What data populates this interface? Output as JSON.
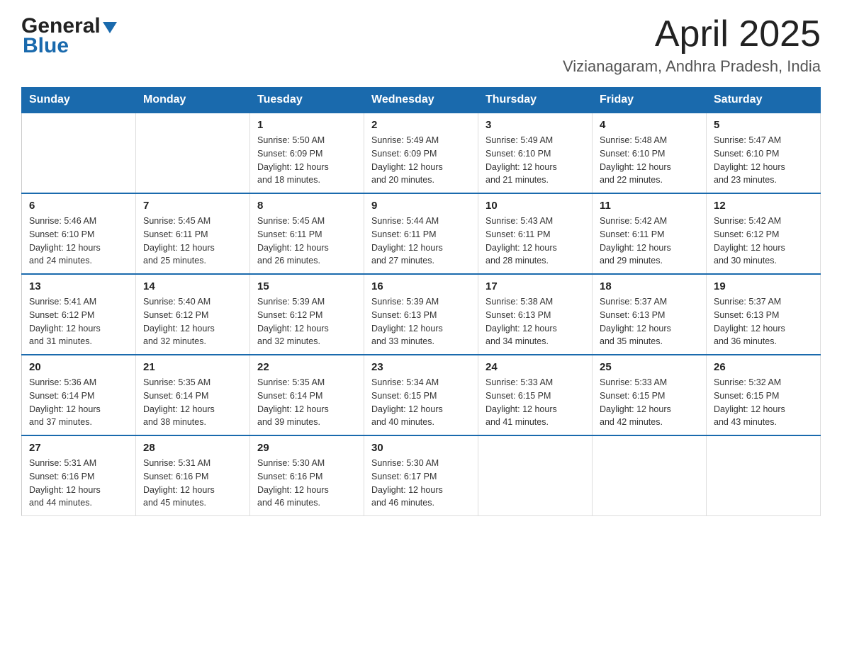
{
  "header": {
    "logo": {
      "general": "General",
      "blue": "Blue"
    },
    "title": "April 2025",
    "location": "Vizianagaram, Andhra Pradesh, India"
  },
  "calendar": {
    "days_of_week": [
      "Sunday",
      "Monday",
      "Tuesday",
      "Wednesday",
      "Thursday",
      "Friday",
      "Saturday"
    ],
    "weeks": [
      [
        {
          "day": "",
          "info": ""
        },
        {
          "day": "",
          "info": ""
        },
        {
          "day": "1",
          "info": "Sunrise: 5:50 AM\nSunset: 6:09 PM\nDaylight: 12 hours\nand 18 minutes."
        },
        {
          "day": "2",
          "info": "Sunrise: 5:49 AM\nSunset: 6:09 PM\nDaylight: 12 hours\nand 20 minutes."
        },
        {
          "day": "3",
          "info": "Sunrise: 5:49 AM\nSunset: 6:10 PM\nDaylight: 12 hours\nand 21 minutes."
        },
        {
          "day": "4",
          "info": "Sunrise: 5:48 AM\nSunset: 6:10 PM\nDaylight: 12 hours\nand 22 minutes."
        },
        {
          "day": "5",
          "info": "Sunrise: 5:47 AM\nSunset: 6:10 PM\nDaylight: 12 hours\nand 23 minutes."
        }
      ],
      [
        {
          "day": "6",
          "info": "Sunrise: 5:46 AM\nSunset: 6:10 PM\nDaylight: 12 hours\nand 24 minutes."
        },
        {
          "day": "7",
          "info": "Sunrise: 5:45 AM\nSunset: 6:11 PM\nDaylight: 12 hours\nand 25 minutes."
        },
        {
          "day": "8",
          "info": "Sunrise: 5:45 AM\nSunset: 6:11 PM\nDaylight: 12 hours\nand 26 minutes."
        },
        {
          "day": "9",
          "info": "Sunrise: 5:44 AM\nSunset: 6:11 PM\nDaylight: 12 hours\nand 27 minutes."
        },
        {
          "day": "10",
          "info": "Sunrise: 5:43 AM\nSunset: 6:11 PM\nDaylight: 12 hours\nand 28 minutes."
        },
        {
          "day": "11",
          "info": "Sunrise: 5:42 AM\nSunset: 6:11 PM\nDaylight: 12 hours\nand 29 minutes."
        },
        {
          "day": "12",
          "info": "Sunrise: 5:42 AM\nSunset: 6:12 PM\nDaylight: 12 hours\nand 30 minutes."
        }
      ],
      [
        {
          "day": "13",
          "info": "Sunrise: 5:41 AM\nSunset: 6:12 PM\nDaylight: 12 hours\nand 31 minutes."
        },
        {
          "day": "14",
          "info": "Sunrise: 5:40 AM\nSunset: 6:12 PM\nDaylight: 12 hours\nand 32 minutes."
        },
        {
          "day": "15",
          "info": "Sunrise: 5:39 AM\nSunset: 6:12 PM\nDaylight: 12 hours\nand 32 minutes."
        },
        {
          "day": "16",
          "info": "Sunrise: 5:39 AM\nSunset: 6:13 PM\nDaylight: 12 hours\nand 33 minutes."
        },
        {
          "day": "17",
          "info": "Sunrise: 5:38 AM\nSunset: 6:13 PM\nDaylight: 12 hours\nand 34 minutes."
        },
        {
          "day": "18",
          "info": "Sunrise: 5:37 AM\nSunset: 6:13 PM\nDaylight: 12 hours\nand 35 minutes."
        },
        {
          "day": "19",
          "info": "Sunrise: 5:37 AM\nSunset: 6:13 PM\nDaylight: 12 hours\nand 36 minutes."
        }
      ],
      [
        {
          "day": "20",
          "info": "Sunrise: 5:36 AM\nSunset: 6:14 PM\nDaylight: 12 hours\nand 37 minutes."
        },
        {
          "day": "21",
          "info": "Sunrise: 5:35 AM\nSunset: 6:14 PM\nDaylight: 12 hours\nand 38 minutes."
        },
        {
          "day": "22",
          "info": "Sunrise: 5:35 AM\nSunset: 6:14 PM\nDaylight: 12 hours\nand 39 minutes."
        },
        {
          "day": "23",
          "info": "Sunrise: 5:34 AM\nSunset: 6:15 PM\nDaylight: 12 hours\nand 40 minutes."
        },
        {
          "day": "24",
          "info": "Sunrise: 5:33 AM\nSunset: 6:15 PM\nDaylight: 12 hours\nand 41 minutes."
        },
        {
          "day": "25",
          "info": "Sunrise: 5:33 AM\nSunset: 6:15 PM\nDaylight: 12 hours\nand 42 minutes."
        },
        {
          "day": "26",
          "info": "Sunrise: 5:32 AM\nSunset: 6:15 PM\nDaylight: 12 hours\nand 43 minutes."
        }
      ],
      [
        {
          "day": "27",
          "info": "Sunrise: 5:31 AM\nSunset: 6:16 PM\nDaylight: 12 hours\nand 44 minutes."
        },
        {
          "day": "28",
          "info": "Sunrise: 5:31 AM\nSunset: 6:16 PM\nDaylight: 12 hours\nand 45 minutes."
        },
        {
          "day": "29",
          "info": "Sunrise: 5:30 AM\nSunset: 6:16 PM\nDaylight: 12 hours\nand 46 minutes."
        },
        {
          "day": "30",
          "info": "Sunrise: 5:30 AM\nSunset: 6:17 PM\nDaylight: 12 hours\nand 46 minutes."
        },
        {
          "day": "",
          "info": ""
        },
        {
          "day": "",
          "info": ""
        },
        {
          "day": "",
          "info": ""
        }
      ]
    ]
  }
}
